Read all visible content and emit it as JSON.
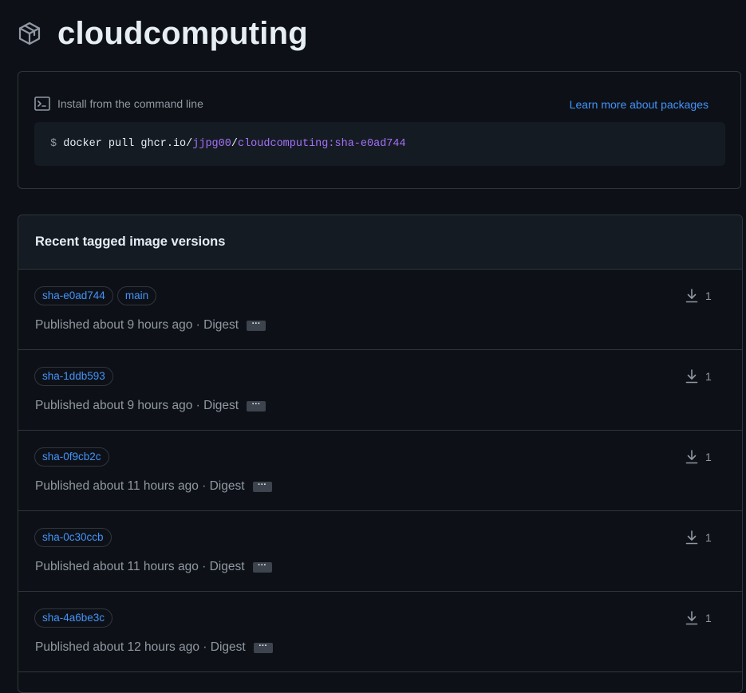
{
  "header": {
    "title": "cloudcomputing",
    "icon": "package-icon"
  },
  "install": {
    "label": "Install from the command line",
    "icon": "terminal-icon",
    "learn_more": "Learn more about packages",
    "command": {
      "prompt": "$",
      "base": "docker pull ghcr.io/",
      "owner": "jjpg00",
      "separator": "/",
      "image": "cloudcomputing:sha-e0ad744"
    }
  },
  "versions": {
    "title": "Recent tagged image versions",
    "digest_label": "Digest",
    "ellipsis": "···",
    "items": [
      {
        "tags": [
          "sha-e0ad744",
          "main"
        ],
        "published": "Published about 9 hours ago",
        "downloads": "1"
      },
      {
        "tags": [
          "sha-1ddb593"
        ],
        "published": "Published about 9 hours ago",
        "downloads": "1"
      },
      {
        "tags": [
          "sha-0f9cb2c"
        ],
        "published": "Published about 11 hours ago",
        "downloads": "1"
      },
      {
        "tags": [
          "sha-0c30ccb"
        ],
        "published": "Published about 11 hours ago",
        "downloads": "1"
      },
      {
        "tags": [
          "sha-4a6be3c"
        ],
        "published": "Published about 12 hours ago",
        "downloads": "1"
      }
    ]
  },
  "colors": {
    "background": "#0d1117",
    "border": "#30363d",
    "link": "#4493f8",
    "muted": "#9198a1",
    "accent_purple": "#a371f7"
  }
}
